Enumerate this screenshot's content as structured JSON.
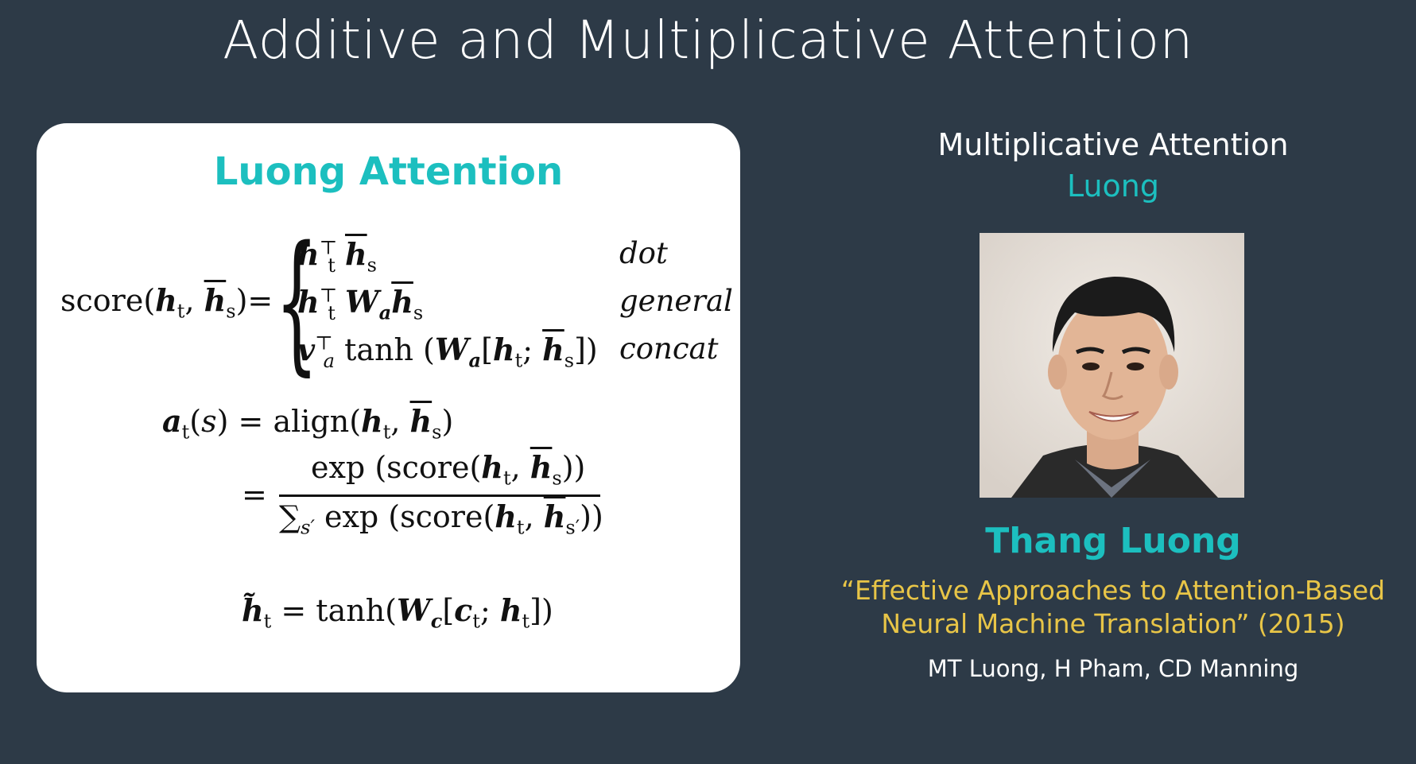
{
  "slide": {
    "title": "Additive and Multiplicative Attention"
  },
  "card": {
    "title": "Luong Attention",
    "score_lhs": "score(h_t, h̄_s) =",
    "cases": [
      {
        "expr": "h_t⊤ h̄_s",
        "label": "dot"
      },
      {
        "expr": "h_t⊤ W_a h̄_s",
        "label": "general"
      },
      {
        "expr": "v_a⊤ tanh(W_a[h_t; h̄_s])",
        "label": "concat"
      }
    ],
    "align_eq": "a_t(s) = align(h_t, h̄_s)",
    "softmax_num": "exp(score(h_t, h̄_s))",
    "softmax_den": "∑_s′ exp(score(h_t, h̄_s′))",
    "tilde_eq": "h̃_t = tanh(W_c[c_t; h_t])"
  },
  "right": {
    "heading": "Multiplicative Attention",
    "subheading": "Luong",
    "person_name": "Thang Luong",
    "paper_title_line1": "“Effective Approaches to Attention-Based",
    "paper_title_line2": "Neural Machine Translation” (2015)",
    "authors": "MT Luong, H Pham, CD Manning"
  },
  "colors": {
    "background": "#2d3a47",
    "accent": "#1cbfbf",
    "paper_title": "#e8c547",
    "card": "#ffffff"
  }
}
